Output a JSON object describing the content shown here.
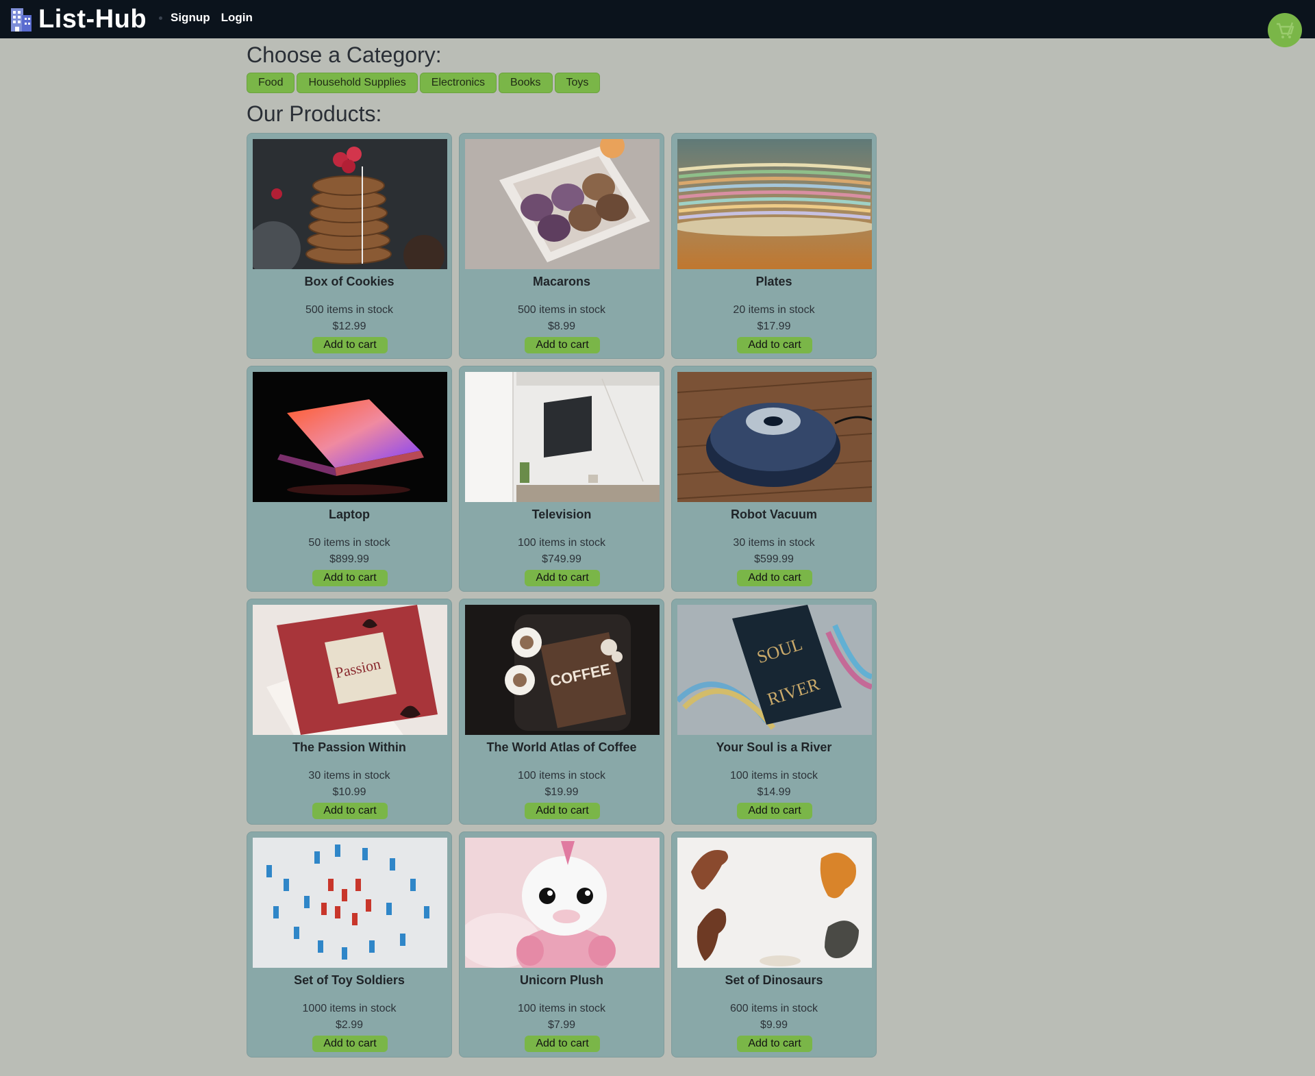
{
  "navbar": {
    "brand": "List-Hub",
    "links": [
      "Signup",
      "Login"
    ],
    "cart_icon": "cart-icon"
  },
  "categories": {
    "heading": "Choose a Category:",
    "items": [
      "Food",
      "Household Supplies",
      "Electronics",
      "Books",
      "Toys"
    ]
  },
  "products_heading": "Our Products:",
  "products": [
    {
      "name": "Box of Cookies",
      "stock": "500 items in stock",
      "price": "$12.99",
      "button": "Add to cart"
    },
    {
      "name": "Macarons",
      "stock": "500 items in stock",
      "price": "$8.99",
      "button": "Add to cart"
    },
    {
      "name": "Plates",
      "stock": "20 items in stock",
      "price": "$17.99",
      "button": "Add to cart"
    },
    {
      "name": "Laptop",
      "stock": "50 items in stock",
      "price": "$899.99",
      "button": "Add to cart"
    },
    {
      "name": "Television",
      "stock": "100 items in stock",
      "price": "$749.99",
      "button": "Add to cart"
    },
    {
      "name": "Robot Vacuum",
      "stock": "30 items in stock",
      "price": "$599.99",
      "button": "Add to cart"
    },
    {
      "name": "The Passion Within",
      "stock": "30 items in stock",
      "price": "$10.99",
      "button": "Add to cart"
    },
    {
      "name": "The World Atlas of Coffee",
      "stock": "100 items in stock",
      "price": "$19.99",
      "button": "Add to cart"
    },
    {
      "name": "Your Soul is a River",
      "stock": "100 items in stock",
      "price": "$14.99",
      "button": "Add to cart"
    },
    {
      "name": "Set of Toy Soldiers",
      "stock": "1000 items in stock",
      "price": "$2.99",
      "button": "Add to cart"
    },
    {
      "name": "Unicorn Plush",
      "stock": "100 items in stock",
      "price": "$7.99",
      "button": "Add to cart"
    },
    {
      "name": "Set of Dinosaurs",
      "stock": "600 items in stock",
      "price": "$9.99",
      "button": "Add to cart"
    }
  ],
  "colors": {
    "navbar": "#0b131c",
    "accent": "#7ab648",
    "card": "#89a8a8",
    "page": "#babdb6"
  }
}
